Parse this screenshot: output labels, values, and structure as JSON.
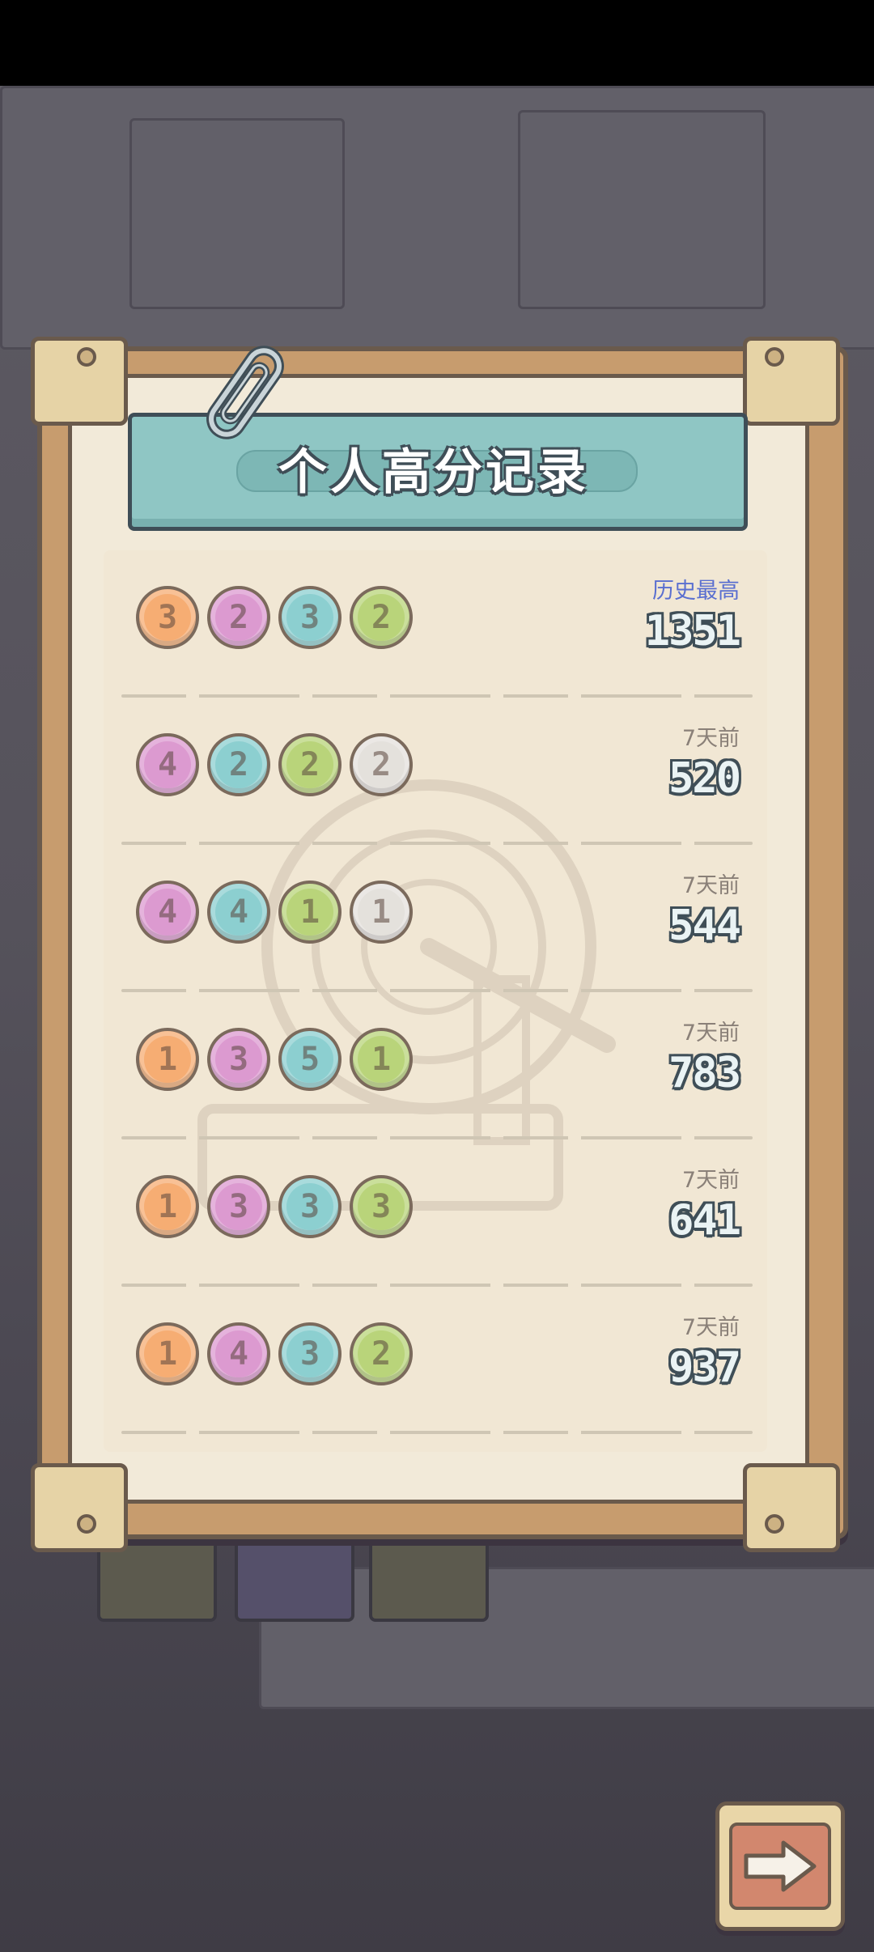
{
  "title": "个人高分记录",
  "colors": {
    "coin_1": "#f6ad73",
    "coin_2_row0": "#dc9ad0",
    "coin_3": "#8ccfd0",
    "coin_4": "#dc9ad0",
    "coin_5": "#8ccfd0",
    "coin_green": "#b9d47a",
    "coin_white": "#e4e1dc"
  },
  "records": [
    {
      "label": "历史最高",
      "score": "1351",
      "best": true,
      "coins": [
        {
          "n": "3",
          "color": "#f6ad73"
        },
        {
          "n": "2",
          "color": "#dc9ad0"
        },
        {
          "n": "3",
          "color": "#8ccfd0"
        },
        {
          "n": "2",
          "color": "#b9d47a"
        }
      ]
    },
    {
      "label": "7天前",
      "score": "520",
      "best": false,
      "coins": [
        {
          "n": "4",
          "color": "#dc9ad0"
        },
        {
          "n": "2",
          "color": "#8ccfd0"
        },
        {
          "n": "2",
          "color": "#b9d47a"
        },
        {
          "n": "2",
          "color": "#e4e1dc"
        }
      ]
    },
    {
      "label": "7天前",
      "score": "544",
      "best": false,
      "coins": [
        {
          "n": "4",
          "color": "#dc9ad0"
        },
        {
          "n": "4",
          "color": "#8ccfd0"
        },
        {
          "n": "1",
          "color": "#b9d47a"
        },
        {
          "n": "1",
          "color": "#e4e1dc"
        }
      ]
    },
    {
      "label": "7天前",
      "score": "783",
      "best": false,
      "coins": [
        {
          "n": "1",
          "color": "#f6ad73"
        },
        {
          "n": "3",
          "color": "#dc9ad0"
        },
        {
          "n": "5",
          "color": "#8ccfd0"
        },
        {
          "n": "1",
          "color": "#b9d47a"
        }
      ]
    },
    {
      "label": "7天前",
      "score": "641",
      "best": false,
      "coins": [
        {
          "n": "1",
          "color": "#f6ad73"
        },
        {
          "n": "3",
          "color": "#dc9ad0"
        },
        {
          "n": "3",
          "color": "#8ccfd0"
        },
        {
          "n": "3",
          "color": "#b9d47a"
        }
      ]
    },
    {
      "label": "7天前",
      "score": "937",
      "best": false,
      "coins": [
        {
          "n": "1",
          "color": "#f6ad73"
        },
        {
          "n": "4",
          "color": "#dc9ad0"
        },
        {
          "n": "3",
          "color": "#8ccfd0"
        },
        {
          "n": "2",
          "color": "#b9d47a"
        }
      ]
    }
  ],
  "icons": {
    "next": "arrow-right-icon",
    "clip": "paperclip-icon",
    "watermark": "grinding-wheel-icon"
  }
}
